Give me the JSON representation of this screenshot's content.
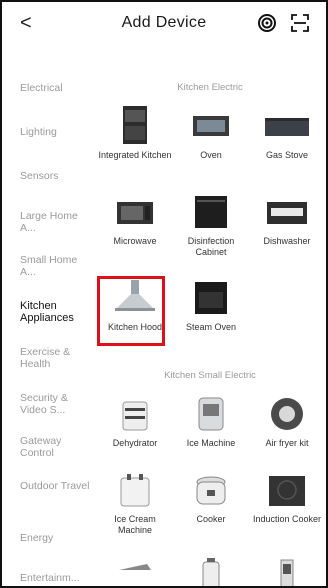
{
  "header": {
    "back_symbol": "<",
    "title": "Add Device",
    "icons": [
      "target-icon",
      "scan-icon"
    ]
  },
  "sidebar": {
    "items": [
      {
        "label": "Electrical"
      },
      {
        "label": "Lighting"
      },
      {
        "label": "Sensors"
      },
      {
        "label": "Large Home A..."
      },
      {
        "label": "Small Home A..."
      },
      {
        "label": "Kitchen Appliances"
      },
      {
        "label": "Exercise & Health"
      },
      {
        "label": "Security & Video S..."
      },
      {
        "label": "Gateway Control"
      },
      {
        "label": "Outdoor Travel"
      },
      {
        "label": "Energy"
      },
      {
        "label": "Entertainm..."
      }
    ]
  },
  "content": {
    "section1": "Kitchen Electric",
    "section2": "Kitchen Small Electric",
    "devices": [
      {
        "label": "Integrated Kitchen"
      },
      {
        "label": "Oven"
      },
      {
        "label": "Gas Stove"
      },
      {
        "label": "Microwave"
      },
      {
        "label": "Disinfection Cabinet"
      },
      {
        "label": "Dishwasher"
      },
      {
        "label": "Kitchen Hood"
      },
      {
        "label": "Steam Oven"
      },
      {
        "label": "Dehydrator"
      },
      {
        "label": "Ice Machine"
      },
      {
        "label": "Air fryer kit"
      },
      {
        "label": "Ice Cream Machine"
      },
      {
        "label": "Cooker"
      },
      {
        "label": "Induction Cooker"
      }
    ]
  },
  "colors": {
    "highlight": "#e0101b",
    "muted_text": "#9a9a9a",
    "active_text": "#111111"
  }
}
